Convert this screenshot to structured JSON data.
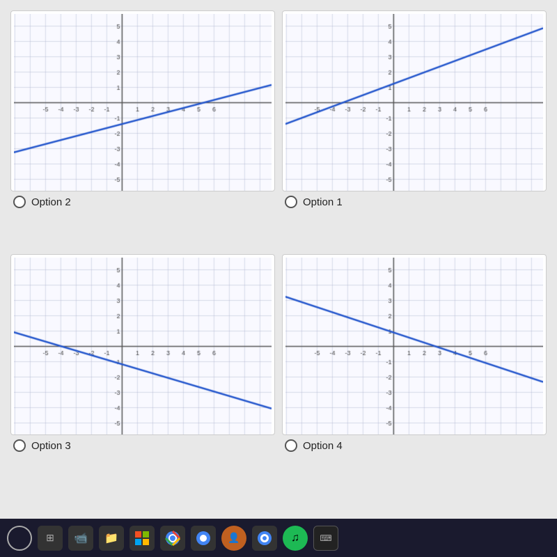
{
  "options": [
    {
      "id": "option2",
      "label": "Option 2",
      "radio_selected": false,
      "line": {
        "x1_frac": 0.0,
        "y1_frac": 0.78,
        "x2_frac": 1.0,
        "y2_frac": 0.35,
        "slope_desc": "gentle positive, starts low-left goes right slightly up"
      }
    },
    {
      "id": "option1",
      "label": "Option 1",
      "radio_selected": false,
      "line": {
        "x1_frac": 0.0,
        "y1_frac": 0.62,
        "x2_frac": 1.0,
        "y2_frac": 0.08,
        "slope_desc": "positive slope, goes from center-left to upper-right"
      }
    },
    {
      "id": "option3",
      "label": "Option 3",
      "radio_selected": false,
      "line": {
        "x1_frac": 0.0,
        "y1_frac": 0.45,
        "x2_frac": 1.0,
        "y2_frac": 0.82,
        "slope_desc": "negative steep slope from left mid to bottom right"
      }
    },
    {
      "id": "option4",
      "label": "Option 4",
      "radio_selected": false,
      "line": {
        "x1_frac": 0.0,
        "y1_frac": 0.22,
        "x2_frac": 1.0,
        "y2_frac": 0.72,
        "slope_desc": "negative slope from upper-left to lower-right gentle"
      }
    }
  ],
  "taskbar": {
    "icons": [
      "○",
      "⊞",
      "📷",
      "📁",
      "⊞",
      "●",
      "●",
      "👤",
      "●",
      "♪",
      "⌨"
    ]
  }
}
